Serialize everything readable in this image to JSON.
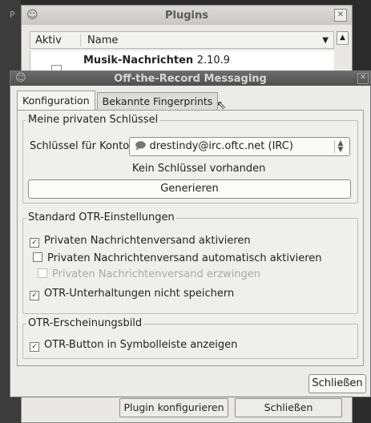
{
  "background_window": {
    "title": "Plugins",
    "columns": [
      "Aktiv",
      "Name"
    ],
    "plugin_name": "Musik-Nachrichten",
    "plugin_version": "2.10.9",
    "button_configure": "Plugin konfigurieren",
    "button_close": "Schließen",
    "edge_char": "P"
  },
  "dialog": {
    "title": "Off-the-Record Messaging",
    "tabs": [
      "Konfiguration",
      "Bekannte Fingerprints"
    ],
    "keys_group": {
      "title": "Meine privaten Schlüssel",
      "account_label": "Schlüssel für Konto:",
      "account_value": "drestindy@irc.oftc.net (IRC)",
      "status": "Kein Schlüssel vorhanden",
      "generate_button": "Generieren"
    },
    "standard_group": {
      "title": "Standard OTR-Einstellungen",
      "options": [
        {
          "label": "Privaten Nachrichtenversand aktivieren",
          "checked": true,
          "enabled": true
        },
        {
          "label": "Privaten Nachrichtenversand automatisch aktivieren",
          "checked": false,
          "enabled": true
        },
        {
          "label": "Privaten Nachrichtenversand erzwingen",
          "checked": false,
          "enabled": false
        },
        {
          "label": "OTR-Unterhaltungen nicht speichern",
          "checked": true,
          "enabled": true
        }
      ]
    },
    "appearance_group": {
      "title": "OTR-Erscheinungsbild",
      "option": {
        "label": "OTR-Button in Symbolleiste anzeigen",
        "checked": true
      }
    },
    "close_button": "Schließen"
  },
  "icons": {
    "window_icon": "pidgin-icon",
    "account_icon": "chat-bubble-icon",
    "cursor": "mouse-pointer-icon"
  },
  "colors": {
    "dialog_titlebar": "#5a5a5a",
    "dialog_bg": "#ebebea",
    "desktop": "#2b2b2b"
  }
}
